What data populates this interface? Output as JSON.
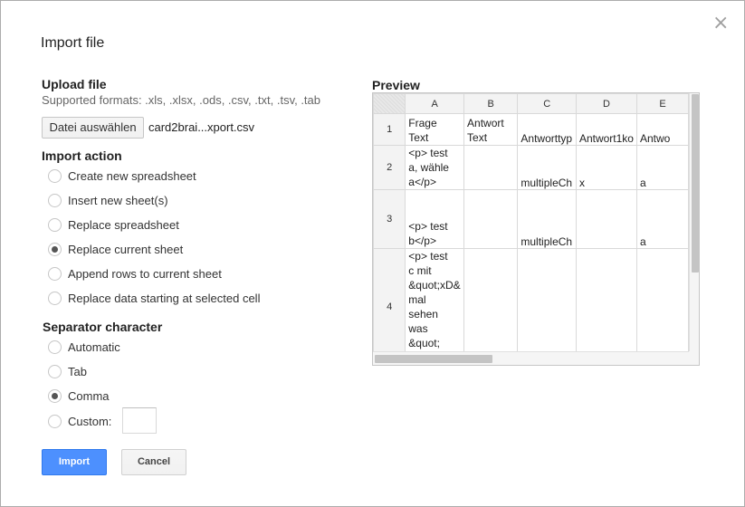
{
  "dialog": {
    "title": "Import file",
    "close_symbol": "×"
  },
  "upload": {
    "title": "Upload file",
    "supported_formats": "Supported formats: .xls, .xlsx, .ods, .csv, .txt, .tsv, .tab",
    "choose_button": "Datei auswählen",
    "file_name": "card2brai...xport.csv"
  },
  "import_action": {
    "title": "Import action",
    "options": [
      {
        "label": "Create new spreadsheet",
        "checked": false
      },
      {
        "label": "Insert new sheet(s)",
        "checked": false
      },
      {
        "label": "Replace spreadsheet",
        "checked": false
      },
      {
        "label": "Replace current sheet",
        "checked": true
      },
      {
        "label": "Append rows to current sheet",
        "checked": false
      },
      {
        "label": "Replace data starting at selected cell",
        "checked": false
      }
    ]
  },
  "separator": {
    "title": "Separator character",
    "options": [
      {
        "label": "Automatic",
        "checked": false
      },
      {
        "label": "Tab",
        "checked": false
      },
      {
        "label": "Comma",
        "checked": true
      },
      {
        "label": "Custom:",
        "checked": false
      }
    ],
    "custom_value": ""
  },
  "buttons": {
    "import": "Import",
    "cancel": "Cancel"
  },
  "preview": {
    "title": "Preview",
    "columns": [
      "A",
      "B",
      "C",
      "D",
      "E"
    ],
    "rows": [
      {
        "num": "1",
        "cells": [
          "Frage\nText",
          "Antwort\nText",
          "Antworttyp",
          "Antwort1ko",
          "Antwo"
        ]
      },
      {
        "num": "2",
        "cells": [
          "<p> test\na, wähle\na</p>",
          "",
          "multipleCh",
          "x",
          "a"
        ]
      },
      {
        "num": "3",
        "cells": [
          "<p> test\nb</p>",
          "",
          "multipleCh",
          "",
          "a"
        ]
      },
      {
        "num": "4",
        "cells": [
          "<p> test\nc mit\n&quot;xD&\nmal\nsehen\nwas\n&quot;",
          "",
          "",
          "",
          ""
        ]
      }
    ]
  },
  "colors": {
    "primary_button": "#4d90fe",
    "radio_checked": "#555555"
  }
}
